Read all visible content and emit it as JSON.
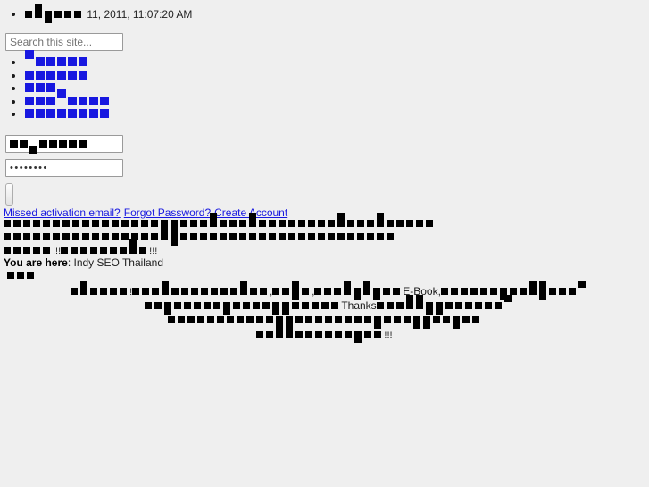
{
  "page": {
    "title": "Indy SEO Thailand",
    "background_color": "#efefef",
    "link_color": "#1818e0",
    "text_color": "#1a1a1a",
    "missing_glyph_note": "Thai text renders as tofu boxes (missing glyphs)"
  },
  "date_row": {
    "tofu_before": 6,
    "text": " 11, 2011, 11:07:20 AM"
  },
  "search": {
    "placeholder": "Search this site...",
    "value": ""
  },
  "nav": {
    "items": [
      {
        "name": "nav-item-1",
        "tofu": 5
      },
      {
        "name": "nav-item-2",
        "tofu": 6
      },
      {
        "name": "nav-item-3",
        "tofu": 3
      },
      {
        "name": "nav-item-4",
        "tofu": 7
      },
      {
        "name": "nav-item-5",
        "tofu": 8
      }
    ]
  },
  "login": {
    "username_tofu": 7,
    "password_value": "••••••••",
    "submit_label": ""
  },
  "account_links": [
    {
      "label": "Missed activation email?"
    },
    {
      "label": "Forgot Password?"
    },
    {
      "label": "Create Account"
    }
  ],
  "tofu_block": {
    "lines": [
      {
        "counts": 44,
        "trailing": ""
      },
      {
        "counts": 40,
        "trailing": ""
      },
      {
        "counts": 5,
        "trailing": "!!!",
        "second_counts": 9,
        "second_trailing": "!!!"
      }
    ]
  },
  "breadcrumb": {
    "prefix": "You are here",
    "separator": ": ",
    "current": "Indy SEO Thailand",
    "tofu_below": 3
  },
  "body_paragraph": {
    "lines": [
      {
        "tofu_a": 6,
        "punct_a": "!",
        "tofu_b": 14,
        "punct_b": ",",
        "tofu_c": 4,
        "punct_c": ",",
        "tofu_d": 9,
        "latin": "E-Book,",
        "tofu_e": 14
      },
      {
        "tofu_a": 3,
        "tofu_b": 17,
        "latin": "Thanks",
        "tofu_c": 11,
        "tofu_d": 2
      },
      {
        "tofu_a": 8,
        "tofu_b": 24
      },
      {
        "tofu_a": 4,
        "tofu_b": 9,
        "punct": "!!!"
      }
    ]
  }
}
